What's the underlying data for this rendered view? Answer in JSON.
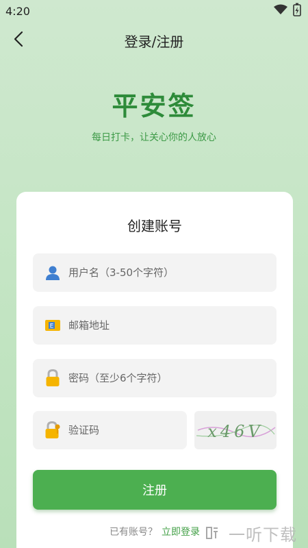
{
  "status_bar": {
    "time": "4:20"
  },
  "header": {
    "title": "登录/注册",
    "back_icon": "back-arrow-icon"
  },
  "brand": {
    "name": "平安签",
    "slogan": "每日打卡，让关心你的人放心"
  },
  "form": {
    "title": "创建账号",
    "username_placeholder": "用户名（3-50个字符）",
    "email_placeholder": "邮箱地址",
    "password_placeholder": "密码（至少6个字符）",
    "captcha_placeholder": "验证码",
    "captcha_text": "x46V",
    "submit_label": "注册",
    "login_prompt": "已有账号？",
    "login_link": "立即登录"
  },
  "watermark": {
    "text": "一听下载"
  },
  "colors": {
    "accent": "#4caf50",
    "brand": "#2e8b3a",
    "link": "#43a047"
  }
}
